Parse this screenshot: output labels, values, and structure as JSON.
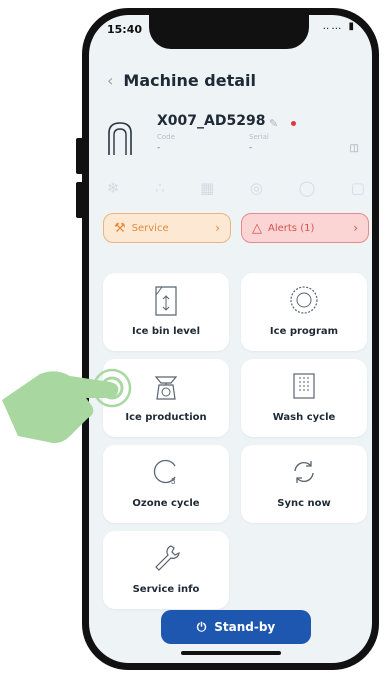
{
  "status_bar": {
    "time": "15:40",
    "icons": "‥… ▮"
  },
  "header": {
    "back": "‹",
    "title": "Machine detail"
  },
  "machine": {
    "name": "X007_AD5298",
    "code_label": "Code",
    "code_value": "-",
    "serial_label": "Serial",
    "serial_value": "-",
    "status_color": "#e03a3a"
  },
  "status_icons": [
    "snowflake-icon",
    "ice-cubes-icon",
    "bin-icon",
    "xd-icon",
    "ozone-icon",
    "alarm-icon"
  ],
  "service": {
    "label": "Service",
    "arrow": "›"
  },
  "alerts": {
    "label": "Alerts (1)",
    "arrow": "›"
  },
  "tiles": [
    {
      "label": "Ice bin level",
      "icon": "ice-bin-icon"
    },
    {
      "label": "Ice program",
      "icon": "ice-program-icon"
    },
    {
      "label": "Ice production",
      "icon": "scale-icon"
    },
    {
      "label": "Wash cycle",
      "icon": "wash-icon"
    },
    {
      "label": "Ozone cycle",
      "icon": "ozone-icon"
    },
    {
      "label": "Sync now",
      "icon": "sync-icon"
    },
    {
      "label": "Service info",
      "icon": "wrench-icon"
    }
  ],
  "standby": {
    "label": "Stand-by",
    "icon": "⏻"
  },
  "colors": {
    "accent": "#1e57b0",
    "service": "#e58a3c",
    "alerts": "#d9534f",
    "hand": "#a8d8a0"
  }
}
